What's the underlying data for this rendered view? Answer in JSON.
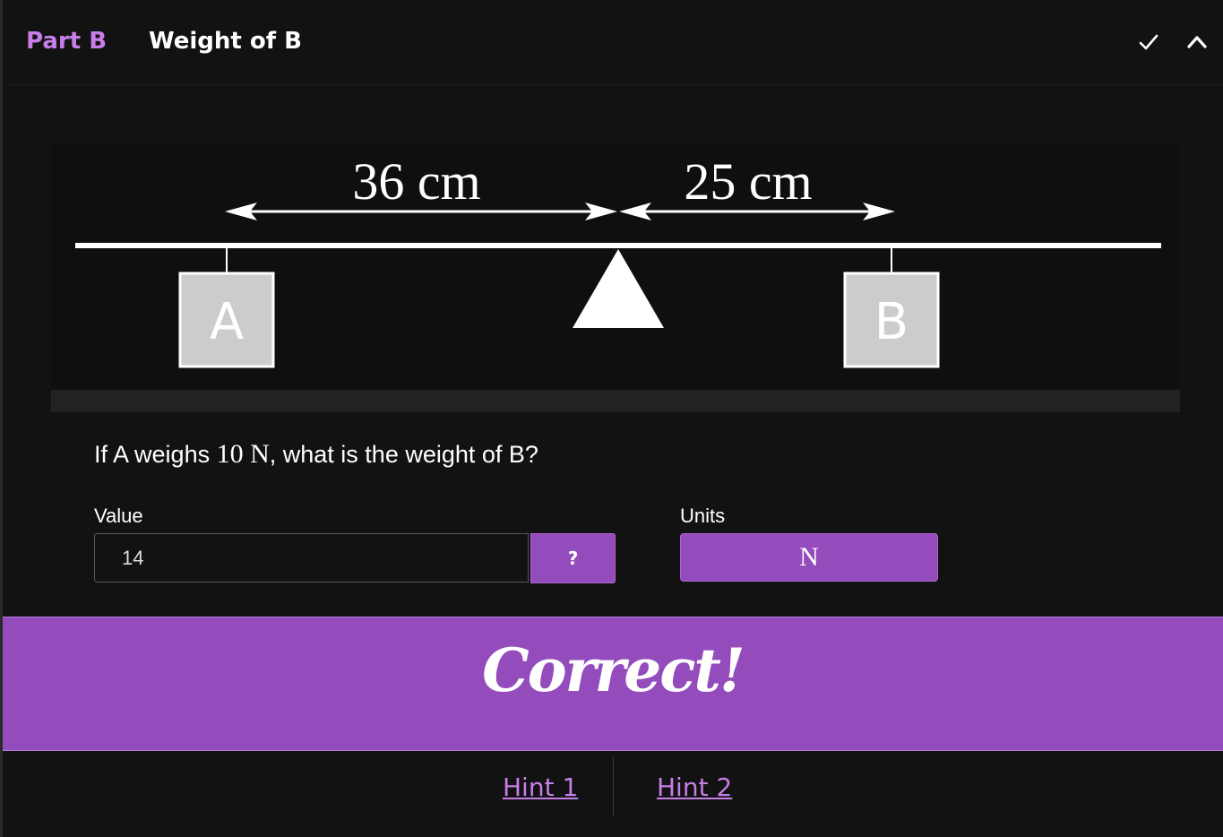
{
  "header": {
    "part_label": "Part B",
    "title": "Weight of B",
    "icons": [
      "check-icon",
      "chevron-up-icon"
    ]
  },
  "diagram": {
    "left_distance": "36 cm",
    "right_distance": "25 cm",
    "mass_left": "A",
    "mass_right": "B",
    "colors": {
      "beam": "#ffffff",
      "mass_fill": "#cccccc",
      "mass_border": "#ffffff"
    }
  },
  "question": {
    "prefix": "If A weighs ",
    "quantity": "10 N",
    "suffix": ", what is the weight of B?"
  },
  "answer": {
    "value_label": "Value",
    "value": "14",
    "help_label": "?",
    "units_label": "Units",
    "units_value": "N"
  },
  "feedback": {
    "message": "Correct!"
  },
  "hints": [
    {
      "label": "Hint 1"
    },
    {
      "label": "Hint 2"
    }
  ],
  "colors": {
    "accent": "#944cbd",
    "accent_text": "#c77ee8",
    "background": "#121212"
  }
}
